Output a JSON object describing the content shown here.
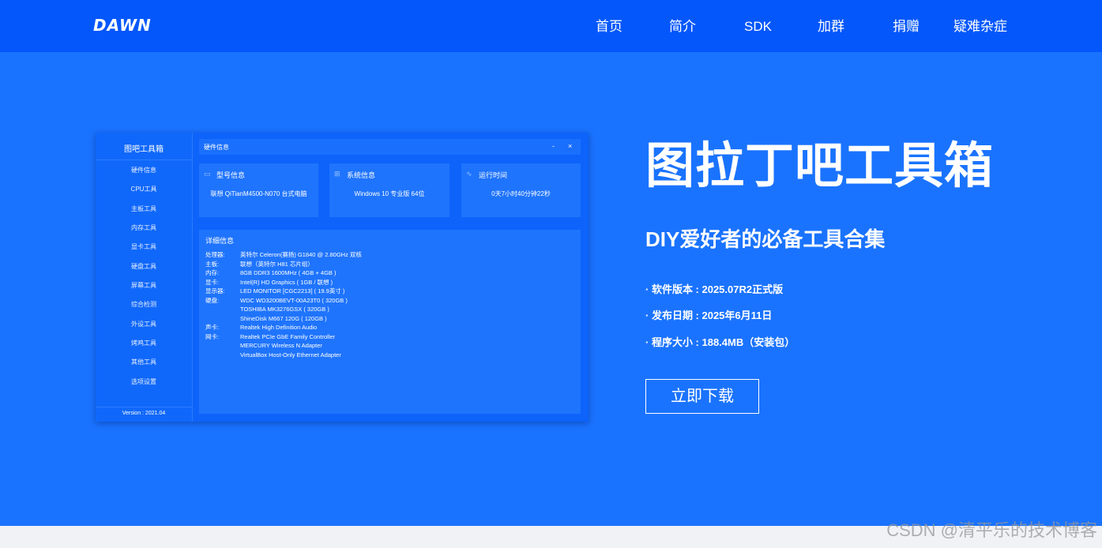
{
  "colors": {
    "nav_bg": "#0457fb",
    "hero_bg": "#1a73fe",
    "app_bg": "#0d63fa",
    "card_bg": "#1f74fd"
  },
  "brand": {
    "logo": "DAWN"
  },
  "nav": {
    "items": [
      "首页",
      "简介",
      "SDK",
      "加群",
      "捐赠",
      "疑难杂症"
    ]
  },
  "app": {
    "title": "图吧工具箱",
    "sidebar": [
      "硬件信息",
      "CPU工具",
      "主板工具",
      "内存工具",
      "显卡工具",
      "硬盘工具",
      "屏幕工具",
      "综合检测",
      "外设工具",
      "烤鸡工具",
      "其他工具",
      "选项设置"
    ],
    "version": "Version : 2021.04",
    "window_title": "硬件信息",
    "window_buttons": {
      "minimize": "-",
      "close": "×"
    },
    "cards": [
      {
        "title": "型号信息",
        "value": "联想 QiTianM4500-N070 台式电脑",
        "icon": "monitor-icon"
      },
      {
        "title": "系统信息",
        "value": "Windows 10 专业版 64位",
        "icon": "windows-icon"
      },
      {
        "title": "运行时间",
        "value": "0天7小时40分钟22秒",
        "icon": "pulse-icon"
      }
    ],
    "detail_title": "详细信息",
    "details": [
      {
        "key": "处理器:",
        "value": "英特尔 Celeron(赛扬) G1840 @ 2.80GHz 双核"
      },
      {
        "key": "主板:",
        "value": "联想（英特尔 H81 芯片组）"
      },
      {
        "key": "内存:",
        "value": "8GB DDR3 1600MHz ( 4GB + 4GB )"
      },
      {
        "key": "显卡:",
        "value": "Intel(R) HD Graphics ( 1GB / 联想 )"
      },
      {
        "key": "显示器:",
        "value": "LED MONITOR [CGC2213] ( 19.9英寸 )"
      },
      {
        "key": "硬盘:",
        "value": "WDC WD3200BEVT-00A23T0 ( 320GB )"
      },
      {
        "key": "",
        "value": "TOSHIBA MK3276GSX ( 320GB )"
      },
      {
        "key": "",
        "value": "ShineDisk M667 120G ( 120GB )"
      },
      {
        "key": "声卡:",
        "value": "Realtek High Definition Audio"
      },
      {
        "key": "网卡:",
        "value": "Realtek PCIe GbE Family Controller"
      },
      {
        "key": "",
        "value": "MERCURY Wireless N Adapter"
      },
      {
        "key": "",
        "value": "VirtualBox Host-Only Ethernet Adapter"
      }
    ]
  },
  "hero": {
    "title": "图拉丁吧工具箱",
    "subtitle": "DIY爱好者的必备工具合集",
    "info": [
      "· 软件版本 : 2025.07R2正式版",
      "· 发布日期 : 2025年6月11日",
      "· 程序大小 : 188.4MB（安装包）"
    ],
    "cta": "立即下载"
  },
  "watermark": "CSDN @清平乐的技术博客"
}
